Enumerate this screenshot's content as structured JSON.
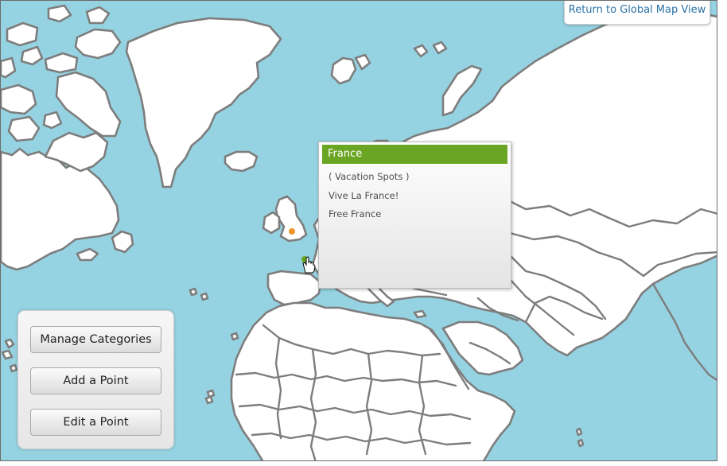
{
  "header": {
    "return_label": "Return to Global Map View"
  },
  "popup": {
    "title": "France",
    "category": "( Vacation Spots )",
    "lines": [
      "Vive La France!",
      "Free France"
    ]
  },
  "panel": {
    "buttons": [
      "Manage Categories",
      "Add a Point",
      "Edit a Point"
    ]
  },
  "markers": [
    {
      "name": "uk-marker",
      "color": "#f0962d"
    },
    {
      "name": "france-marker",
      "color": "#6aa623"
    }
  ],
  "colors": {
    "ocean": "#96d3e2",
    "land": "#ffffff",
    "border": "#7d7d7d",
    "accent": "#6aa623",
    "link": "#2a72a8"
  }
}
